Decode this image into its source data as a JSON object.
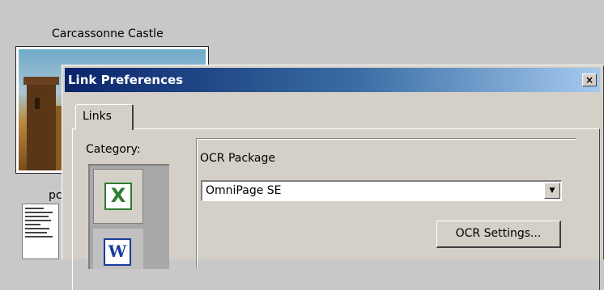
{
  "background": {
    "thumbnail_caption": "Carcassonne Castle",
    "doc_caption_partial": "pc"
  },
  "dialog": {
    "title": "Link Preferences",
    "close_glyph": "×",
    "tabs": [
      {
        "label": "Links",
        "selected": true
      }
    ],
    "category_label": "Category:",
    "categories": [
      {
        "icon": "excel-icon",
        "glyph": "X",
        "selected": true
      },
      {
        "icon": "word-icon",
        "glyph": "W",
        "selected": false
      }
    ],
    "ocr_group": {
      "title": "OCR Package",
      "selected_package": "OmniPage SE",
      "settings_button": "OCR Settings..."
    }
  },
  "colors": {
    "titlebar_start": "#0a246a",
    "titlebar_end": "#a6caf0",
    "dialog_face": "#d4d0c8",
    "excel_green": "#2e7d32",
    "word_blue": "#1a3c9c"
  }
}
